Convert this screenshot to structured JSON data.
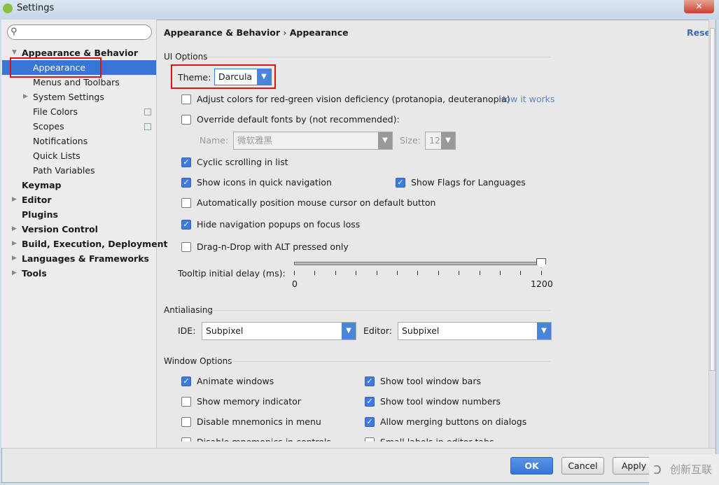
{
  "window": {
    "title": "Settings",
    "close_icon": "close-icon"
  },
  "sidebar": {
    "search_placeholder": "",
    "items": [
      {
        "label": "Appearance & Behavior",
        "level": 0,
        "bold": true,
        "expanded": true
      },
      {
        "label": "Appearance",
        "level": 1,
        "selected": true
      },
      {
        "label": "Menus and Toolbars",
        "level": 1
      },
      {
        "label": "System Settings",
        "level": 1,
        "collapsed": true
      },
      {
        "label": "File Colors",
        "level": 1,
        "copy": true
      },
      {
        "label": "Scopes",
        "level": 1,
        "copy": true
      },
      {
        "label": "Notifications",
        "level": 1
      },
      {
        "label": "Quick Lists",
        "level": 1
      },
      {
        "label": "Path Variables",
        "level": 1
      },
      {
        "label": "Keymap",
        "level": 0,
        "bold": true
      },
      {
        "label": "Editor",
        "level": 0,
        "bold": true,
        "collapsed": true
      },
      {
        "label": "Plugins",
        "level": 0,
        "bold": true
      },
      {
        "label": "Version Control",
        "level": 0,
        "bold": true,
        "collapsed": true
      },
      {
        "label": "Build, Execution, Deployment",
        "level": 0,
        "bold": true,
        "collapsed": true
      },
      {
        "label": "Languages & Frameworks",
        "level": 0,
        "bold": true,
        "collapsed": true
      },
      {
        "label": "Tools",
        "level": 0,
        "bold": true,
        "collapsed": true
      }
    ]
  },
  "header": {
    "crumb1": "Appearance & Behavior",
    "sep": "›",
    "crumb2": "Appearance",
    "reset": "Reset"
  },
  "ui": {
    "section": "UI Options",
    "theme_label": "Theme:",
    "theme_value": "Darcula",
    "adjust": "Adjust colors for red-green vision deficiency (protanopia, deuteranopia)",
    "how": "How it works",
    "override": "Override default fonts by (not recommended):",
    "name_label": "Name:",
    "name_value": "微软雅黑",
    "size_label": "Size:",
    "size_value": "12",
    "cyclic": "Cyclic scrolling in list",
    "icons": "Show icons in quick navigation",
    "flags": "Show Flags for Languages",
    "mouse": "Automatically position mouse cursor on default button",
    "hide": "Hide navigation popups on focus loss",
    "dnd": "Drag-n-Drop with ALT pressed only",
    "tooltip_label": "Tooltip initial delay (ms):",
    "slider_min": "0",
    "slider_max": "1200",
    "slider_value": 1200
  },
  "aa": {
    "section": "Antialiasing",
    "ide_label": "IDE:",
    "ide_value": "Subpixel",
    "editor_label": "Editor:",
    "editor_value": "Subpixel"
  },
  "wo": {
    "section": "Window Options",
    "left": [
      {
        "label": "Animate windows",
        "on": true
      },
      {
        "label": "Show memory indicator",
        "on": false
      },
      {
        "label": "Disable mnemonics in menu",
        "on": false
      },
      {
        "label": "Disable mnemonics in controls",
        "on": false
      }
    ],
    "right": [
      {
        "label": "Show tool window bars",
        "on": true
      },
      {
        "label": "Show tool window numbers",
        "on": true
      },
      {
        "label": "Allow merging buttons on dialogs",
        "on": true
      },
      {
        "label": "Small labels in editor tabs",
        "on": false
      }
    ]
  },
  "footer": {
    "ok": "OK",
    "cancel": "Cancel",
    "apply": "Apply"
  },
  "watermark": "创新互联"
}
